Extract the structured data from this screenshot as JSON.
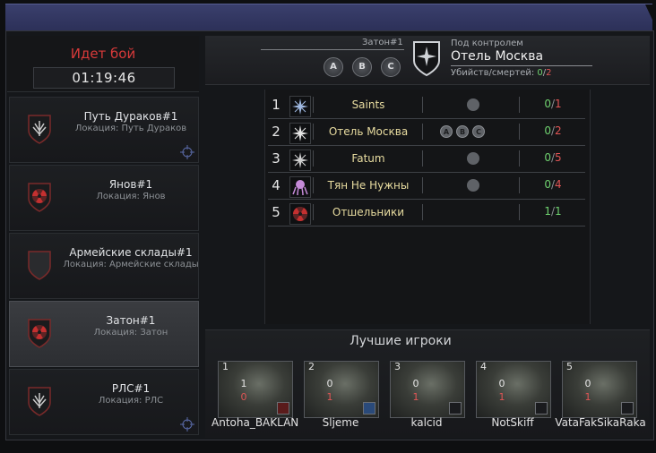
{
  "battle": {
    "status": "Идет бой",
    "timer": "01:19:46"
  },
  "locations": [
    {
      "name": "Путь Дураков#1",
      "sublabel": "Локация: Путь Дураков",
      "emblem": "wings-emblem",
      "active": false,
      "target": true
    },
    {
      "name": "Янов#1",
      "sublabel": "Локация: Янов",
      "emblem": "radiation-emblem",
      "active": false,
      "target": false
    },
    {
      "name": "Армейские склады#1",
      "sublabel": "Локация: Армейские склады",
      "emblem": "empty-emblem",
      "active": false,
      "target": false
    },
    {
      "name": "Затон#1",
      "sublabel": "Локация: Затон",
      "emblem": "radiation-emblem",
      "active": true,
      "target": false
    },
    {
      "name": "РЛС#1",
      "sublabel": "Локация: РЛС",
      "emblem": "wings-emblem",
      "active": false,
      "target": true
    }
  ],
  "control": {
    "zone": "Затон#1",
    "points": [
      "A",
      "B",
      "C"
    ],
    "under_control_label": "Под контролем",
    "owner": "Отель Москва",
    "kd_label": "Убийств/смертей:",
    "kills": "0",
    "deaths": "2"
  },
  "clans": [
    {
      "rank": "1",
      "name": "Saints",
      "points": "flag",
      "kills": "0",
      "deaths": "1",
      "icon": "compass-star-icon"
    },
    {
      "rank": "2",
      "name": "Отель Москва",
      "points": [
        "A",
        "B",
        "C"
      ],
      "kills": "0",
      "deaths": "2",
      "icon": "compass-star-icon"
    },
    {
      "rank": "3",
      "name": "Fatum",
      "points": "flag",
      "kills": "0",
      "deaths": "5",
      "icon": "compass-star-icon"
    },
    {
      "rank": "4",
      "name": "Тян Не Нужны",
      "points": "flag",
      "kills": "0",
      "deaths": "4",
      "icon": "octopus-icon"
    },
    {
      "rank": "5",
      "name": "Отшельники",
      "points": "",
      "kills": "1",
      "deaths": "1",
      "icon": "radiation-icon"
    }
  ],
  "best_players": {
    "title": "Лучшие игроки",
    "players": [
      {
        "rank": "1",
        "name": "Antoha_BAKLAN",
        "kills": "1",
        "deaths": "0",
        "badge": "radiation-badge"
      },
      {
        "rank": "2",
        "name": "Sljeme",
        "kills": "0",
        "deaths": "1",
        "badge": "star-badge"
      },
      {
        "rank": "3",
        "name": "kalcid",
        "kills": "0",
        "deaths": "1",
        "badge": "star-badge"
      },
      {
        "rank": "4",
        "name": "NotSkiff",
        "kills": "0",
        "deaths": "1",
        "badge": "star-badge"
      },
      {
        "rank": "5",
        "name": "VataFakSikaRaka",
        "kills": "0",
        "deaths": "1",
        "badge": "star-badge"
      }
    ]
  },
  "colors": {
    "accent": "#3a3f6c",
    "kills": "#6fd16f",
    "deaths": "#e05555",
    "alert": "#d83a3a",
    "clan_name": "#e8dca0"
  }
}
